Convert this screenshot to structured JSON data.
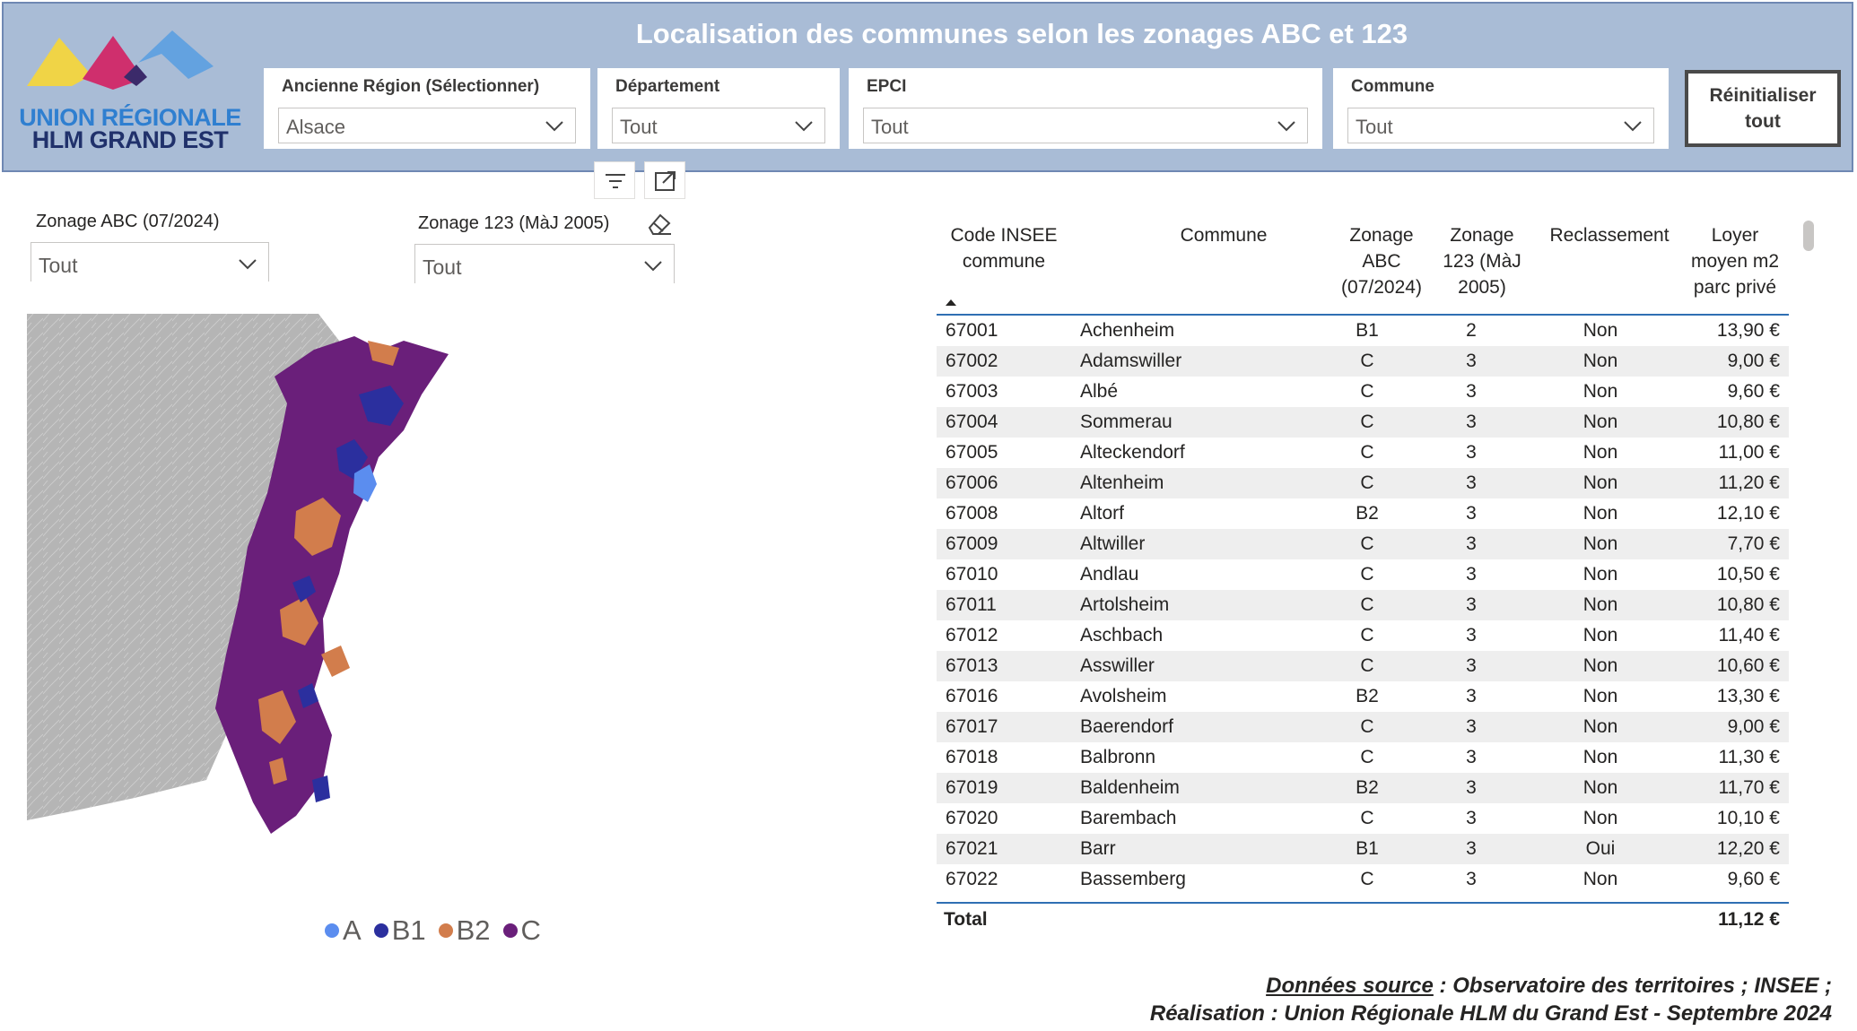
{
  "logo": {
    "line1": "UNION RÉGIONALE",
    "line2": "HLM GRAND EST"
  },
  "header": {
    "title": "Localisation des communes selon les zonages ABC et 123"
  },
  "slicers": {
    "region": {
      "label": "Ancienne Région (Sélectionner)",
      "value": "Alsace"
    },
    "departement": {
      "label": "Département",
      "value": "Tout"
    },
    "epci": {
      "label": "EPCI",
      "value": "Tout"
    },
    "commune": {
      "label": "Commune",
      "value": "Tout"
    }
  },
  "reset_button": {
    "label": "Réinitialiser tout"
  },
  "visual_header": {
    "icons": [
      "filter-icon",
      "focus-mode-icon"
    ]
  },
  "filters": {
    "zonage_abc": {
      "label": "Zonage ABC (07/2024)",
      "value": "Tout"
    },
    "zonage_123": {
      "label": "Zonage 123 (MàJ 2005)",
      "value": "Tout"
    },
    "clear_icon": "eraser-icon"
  },
  "map": {
    "legend": [
      {
        "label": "A",
        "color": "#5b8def"
      },
      {
        "label": "B1",
        "color": "#2b2f9e"
      },
      {
        "label": "B2",
        "color": "#d27d4c"
      },
      {
        "label": "C",
        "color": "#6a1f7a"
      }
    ],
    "outside_color": "#b5b5b5"
  },
  "table": {
    "headers": {
      "code": "Code INSEE commune",
      "commune": "Commune",
      "zonage_abc": "Zonage ABC (07/2024)",
      "zonage_123": "Zonage 123 (MàJ 2005)",
      "reclassement": "Reclassement",
      "loyer": "Loyer moyen m2 parc privé"
    },
    "rows": [
      {
        "code": "67001",
        "commune": "Achenheim",
        "abc": "B1",
        "z123": "2",
        "rec": "Non",
        "loyer": "13,90 €"
      },
      {
        "code": "67002",
        "commune": "Adamswiller",
        "abc": "C",
        "z123": "3",
        "rec": "Non",
        "loyer": "9,00 €"
      },
      {
        "code": "67003",
        "commune": "Albé",
        "abc": "C",
        "z123": "3",
        "rec": "Non",
        "loyer": "9,60 €"
      },
      {
        "code": "67004",
        "commune": "Sommerau",
        "abc": "C",
        "z123": "3",
        "rec": "Non",
        "loyer": "10,80 €"
      },
      {
        "code": "67005",
        "commune": "Alteckendorf",
        "abc": "C",
        "z123": "3",
        "rec": "Non",
        "loyer": "11,00 €"
      },
      {
        "code": "67006",
        "commune": "Altenheim",
        "abc": "C",
        "z123": "3",
        "rec": "Non",
        "loyer": "11,20 €"
      },
      {
        "code": "67008",
        "commune": "Altorf",
        "abc": "B2",
        "z123": "3",
        "rec": "Non",
        "loyer": "12,10 €"
      },
      {
        "code": "67009",
        "commune": "Altwiller",
        "abc": "C",
        "z123": "3",
        "rec": "Non",
        "loyer": "7,70 €"
      },
      {
        "code": "67010",
        "commune": "Andlau",
        "abc": "C",
        "z123": "3",
        "rec": "Non",
        "loyer": "10,50 €"
      },
      {
        "code": "67011",
        "commune": "Artolsheim",
        "abc": "C",
        "z123": "3",
        "rec": "Non",
        "loyer": "10,80 €"
      },
      {
        "code": "67012",
        "commune": "Aschbach",
        "abc": "C",
        "z123": "3",
        "rec": "Non",
        "loyer": "11,40 €"
      },
      {
        "code": "67013",
        "commune": "Asswiller",
        "abc": "C",
        "z123": "3",
        "rec": "Non",
        "loyer": "10,60 €"
      },
      {
        "code": "67016",
        "commune": "Avolsheim",
        "abc": "B2",
        "z123": "3",
        "rec": "Non",
        "loyer": "13,30 €"
      },
      {
        "code": "67017",
        "commune": "Baerendorf",
        "abc": "C",
        "z123": "3",
        "rec": "Non",
        "loyer": "9,00 €"
      },
      {
        "code": "67018",
        "commune": "Balbronn",
        "abc": "C",
        "z123": "3",
        "rec": "Non",
        "loyer": "11,30 €"
      },
      {
        "code": "67019",
        "commune": "Baldenheim",
        "abc": "B2",
        "z123": "3",
        "rec": "Non",
        "loyer": "11,70 €"
      },
      {
        "code": "67020",
        "commune": "Barembach",
        "abc": "C",
        "z123": "3",
        "rec": "Non",
        "loyer": "10,10 €"
      },
      {
        "code": "67021",
        "commune": "Barr",
        "abc": "B1",
        "z123": "3",
        "rec": "Oui",
        "loyer": "12,20 €"
      },
      {
        "code": "67022",
        "commune": "Bassemberg",
        "abc": "C",
        "z123": "3",
        "rec": "Non",
        "loyer": "9,60 €"
      }
    ],
    "total": {
      "label": "Total",
      "value": "11,12 €"
    }
  },
  "source": {
    "prefix": "Données source",
    "line1_rest": " : Observatoire des territoires ; INSEE ;",
    "line2": "Réalisation : Union Régionale HLM du Grand Est - Septembre 2024"
  }
}
